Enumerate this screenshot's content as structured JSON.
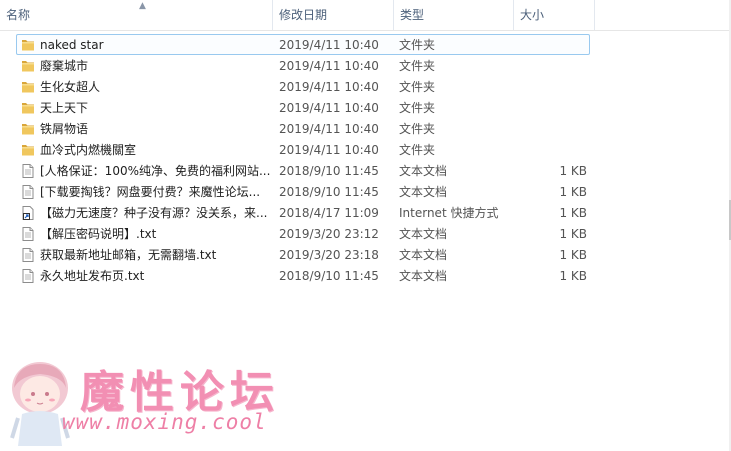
{
  "columns": {
    "name": "名称",
    "date": "修改日期",
    "type": "类型",
    "size": "大小"
  },
  "files": [
    {
      "name": "naked star",
      "date": "2019/4/11 10:40",
      "type": "文件夹",
      "size": "",
      "icon": "folder-icon",
      "selected": true
    },
    {
      "name": "廢棄城市",
      "date": "2019/4/11 10:40",
      "type": "文件夹",
      "size": "",
      "icon": "folder-icon"
    },
    {
      "name": "生化女超人",
      "date": "2019/4/11 10:40",
      "type": "文件夹",
      "size": "",
      "icon": "folder-icon"
    },
    {
      "name": "天上天下",
      "date": "2019/4/11 10:40",
      "type": "文件夹",
      "size": "",
      "icon": "folder-icon"
    },
    {
      "name": "铁屑物语",
      "date": "2019/4/11 10:40",
      "type": "文件夹",
      "size": "",
      "icon": "folder-icon"
    },
    {
      "name": "血冷式内燃機關室",
      "date": "2019/4/11 10:40",
      "type": "文件夹",
      "size": "",
      "icon": "folder-icon"
    },
    {
      "name": "[人格保证：100%纯净、免费的福利网站...",
      "date": "2018/9/10 11:45",
      "type": "文本文档",
      "size": "1 KB",
      "icon": "text-file-icon"
    },
    {
      "name": "[下载要掏钱？网盘要付费？来魔性论坛...",
      "date": "2018/9/10 11:45",
      "type": "文本文档",
      "size": "1 KB",
      "icon": "text-file-icon"
    },
    {
      "name": "【磁力无速度？种子没有源？没关系，来...",
      "date": "2018/4/17 11:09",
      "type": "Internet 快捷方式",
      "size": "1 KB",
      "icon": "internet-shortcut-icon"
    },
    {
      "name": "【解压密码说明】.txt",
      "date": "2019/3/20 23:12",
      "type": "文本文档",
      "size": "1 KB",
      "icon": "text-file-icon"
    },
    {
      "name": "获取最新地址邮箱，无需翻墙.txt",
      "date": "2019/3/20 23:18",
      "type": "文本文档",
      "size": "1 KB",
      "icon": "text-file-icon"
    },
    {
      "name": "永久地址发布页.txt",
      "date": "2018/9/10 11:45",
      "type": "文本文档",
      "size": "1 KB",
      "icon": "text-file-icon"
    }
  ],
  "watermark": {
    "title": "魔性论坛",
    "url": "www.moxing.cool"
  },
  "colors": {
    "header_text": "#4c607a",
    "selection_border": "#99c9ef",
    "folder": "#e8b94a",
    "watermark": "#f28fb3"
  }
}
